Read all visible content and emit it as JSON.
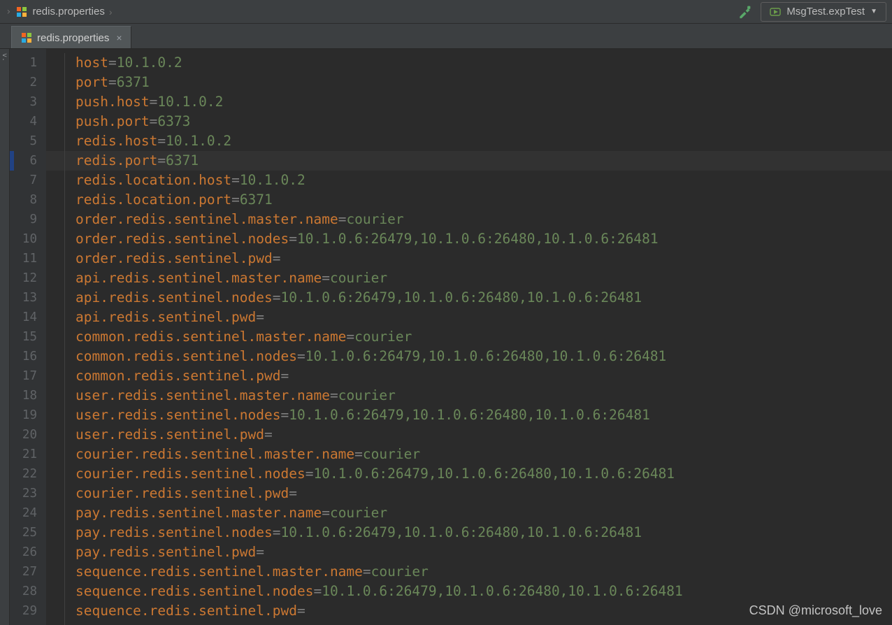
{
  "breadcrumb": {
    "file": "redis.properties"
  },
  "run_config": {
    "label": "MsgTest.expTest"
  },
  "tab": {
    "label": "redis.properties"
  },
  "sidebar_stub": "v.",
  "current_line": 6,
  "lines": [
    {
      "n": 1,
      "key": "host",
      "val": "10.1.0.2"
    },
    {
      "n": 2,
      "key": "port",
      "val": "6371"
    },
    {
      "n": 3,
      "key": "push.host",
      "val": "10.1.0.2"
    },
    {
      "n": 4,
      "key": "push.port",
      "val": "6373"
    },
    {
      "n": 5,
      "key": "redis.host",
      "val": "10.1.0.2"
    },
    {
      "n": 6,
      "key": "redis.port",
      "val": "6371"
    },
    {
      "n": 7,
      "key": "redis.location.host",
      "val": "10.1.0.2"
    },
    {
      "n": 8,
      "key": "redis.location.port",
      "val": "6371"
    },
    {
      "n": 9,
      "key": "order.redis.sentinel.master.name",
      "val": "courier"
    },
    {
      "n": 10,
      "key": "order.redis.sentinel.nodes",
      "val": "10.1.0.6:26479,10.1.0.6:26480,10.1.0.6:26481"
    },
    {
      "n": 11,
      "key": "order.redis.sentinel.pwd",
      "val": ""
    },
    {
      "n": 12,
      "key": "api.redis.sentinel.master.name",
      "val": "courier"
    },
    {
      "n": 13,
      "key": "api.redis.sentinel.nodes",
      "val": "10.1.0.6:26479,10.1.0.6:26480,10.1.0.6:26481"
    },
    {
      "n": 14,
      "key": "api.redis.sentinel.pwd",
      "val": ""
    },
    {
      "n": 15,
      "key": "common.redis.sentinel.master.name",
      "val": "courier"
    },
    {
      "n": 16,
      "key": "common.redis.sentinel.nodes",
      "val": "10.1.0.6:26479,10.1.0.6:26480,10.1.0.6:26481"
    },
    {
      "n": 17,
      "key": "common.redis.sentinel.pwd",
      "val": ""
    },
    {
      "n": 18,
      "key": "user.redis.sentinel.master.name",
      "val": "courier"
    },
    {
      "n": 19,
      "key": "user.redis.sentinel.nodes",
      "val": "10.1.0.6:26479,10.1.0.6:26480,10.1.0.6:26481"
    },
    {
      "n": 20,
      "key": "user.redis.sentinel.pwd",
      "val": ""
    },
    {
      "n": 21,
      "key": "courier.redis.sentinel.master.name",
      "val": "courier"
    },
    {
      "n": 22,
      "key": "courier.redis.sentinel.nodes",
      "val": "10.1.0.6:26479,10.1.0.6:26480,10.1.0.6:26481"
    },
    {
      "n": 23,
      "key": "courier.redis.sentinel.pwd",
      "val": ""
    },
    {
      "n": 24,
      "key": "pay.redis.sentinel.master.name",
      "val": "courier"
    },
    {
      "n": 25,
      "key": "pay.redis.sentinel.nodes",
      "val": "10.1.0.6:26479,10.1.0.6:26480,10.1.0.6:26481"
    },
    {
      "n": 26,
      "key": "pay.redis.sentinel.pwd",
      "val": ""
    },
    {
      "n": 27,
      "key": "sequence.redis.sentinel.master.name",
      "val": "courier"
    },
    {
      "n": 28,
      "key": "sequence.redis.sentinel.nodes",
      "val": "10.1.0.6:26479,10.1.0.6:26480,10.1.0.6:26481"
    },
    {
      "n": 29,
      "key": "sequence.redis.sentinel.pwd",
      "val": ""
    }
  ],
  "watermark": "CSDN @microsoft_love"
}
